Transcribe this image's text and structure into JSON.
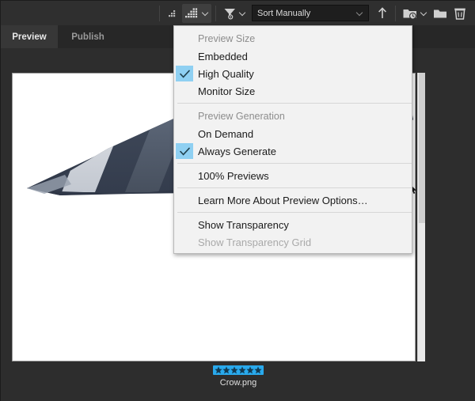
{
  "toolbar": {
    "thumb_small_icon": "thumbnail-small-icon",
    "thumb_large_icon": "thumbnail-large-icon",
    "filter_icon": "filter-funnel-icon",
    "sort_value": "Sort Manually",
    "sort_chevron_icon": "chevron-down-icon",
    "up_arrow_icon": "arrow-up-icon",
    "recent_folder_icon": "recent-folder-icon",
    "new_folder_icon": "new-folder-icon",
    "delete_icon": "trash-icon",
    "accent_active_bg": "#3f3f3f"
  },
  "tabs": [
    {
      "label": "Preview",
      "active": true
    },
    {
      "label": "Publish",
      "active": false
    }
  ],
  "menu": {
    "title_icon": "preview-options-menu",
    "check_highlight_color": "#8fd0f2",
    "groups": [
      {
        "header": "Preview Size",
        "items": [
          {
            "label": "Embedded",
            "checked": false,
            "disabled": false
          },
          {
            "label": "High Quality",
            "checked": true,
            "disabled": false
          },
          {
            "label": "Monitor Size",
            "checked": false,
            "disabled": false
          }
        ]
      },
      {
        "header": "Preview Generation",
        "items": [
          {
            "label": "On Demand",
            "checked": false,
            "disabled": false
          },
          {
            "label": "Always Generate",
            "checked": true,
            "disabled": false
          }
        ]
      },
      {
        "header": null,
        "items": [
          {
            "label": "100% Previews",
            "checked": false,
            "disabled": false
          }
        ]
      },
      {
        "header": null,
        "items": [
          {
            "label": "Learn More About Preview Options…",
            "checked": false,
            "disabled": false
          }
        ]
      },
      {
        "header": null,
        "items": [
          {
            "label": "Show Transparency",
            "checked": false,
            "disabled": false
          },
          {
            "label": "Show Transparency Grid",
            "checked": false,
            "disabled": true
          }
        ]
      }
    ]
  },
  "canvas": {
    "artwork_name": "crow-illustration",
    "background": "#ffffff",
    "scrollbar_icon": "vertical-scrollbar"
  },
  "file": {
    "name": "Crow.png",
    "rating_stars": 6,
    "rating_badge_color": "#29a9ec"
  }
}
